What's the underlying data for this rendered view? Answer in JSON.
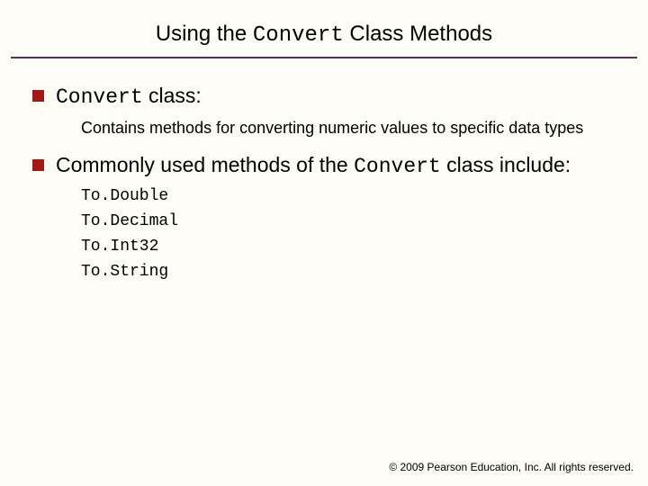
{
  "title": {
    "pre": "Using the ",
    "code": "Convert",
    "post": " Class Methods"
  },
  "bullets": [
    {
      "lead_code": "Convert",
      "lead_rest": " class:",
      "sub": "Contains methods for converting numeric values to specific data types"
    },
    {
      "text_pre": "Commonly used methods of the ",
      "text_code": "Convert",
      "text_post": " class include:",
      "methods": [
        "To.Double",
        "To.Decimal",
        "To.Int32",
        "To.String"
      ]
    }
  ],
  "footer": "©  2009 Pearson Education, Inc.  All rights reserved."
}
